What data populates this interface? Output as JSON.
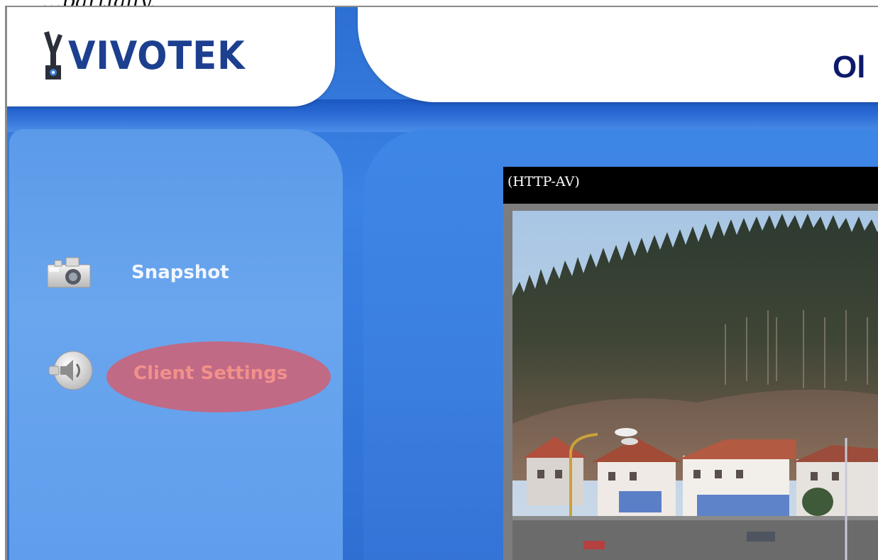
{
  "page": {
    "top_fragment": "...partially."
  },
  "brand": {
    "logo_text": "VIVOTEK",
    "colors": {
      "logo_blue": "#1d3f8f",
      "title_navy": "#0d1a6b",
      "frame_blue": "#3478dc",
      "highlight_pink": "#c06a86",
      "highlight_text": "#f2908a"
    }
  },
  "header": {
    "title_visible": "Ol"
  },
  "sidebar": {
    "items": [
      {
        "label": "Snapshot",
        "icon": "camera-icon"
      },
      {
        "label": "Client Settings",
        "icon": "speaker-icon",
        "highlighted": true
      }
    ]
  },
  "viewer": {
    "stream_label": "(HTTP-AV)",
    "image": "live-camera-feed"
  }
}
